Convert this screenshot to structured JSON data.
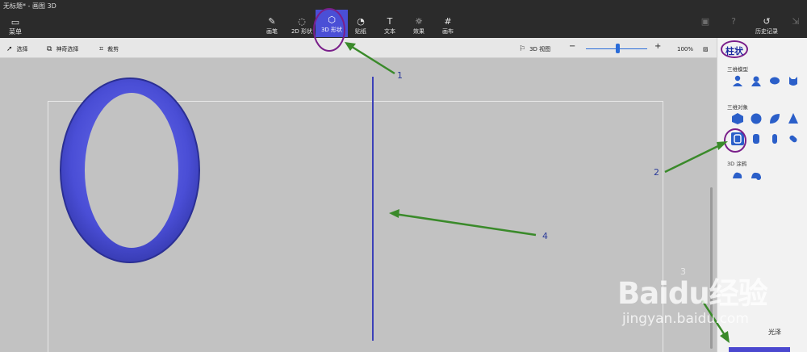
{
  "window": {
    "title": "无标题* - 画图 3D"
  },
  "menu": {
    "label": "菜单"
  },
  "toolbar": {
    "tools": [
      {
        "label": "画笔",
        "icon": "brush-icon"
      },
      {
        "label": "2D 形状",
        "icon": "2d-shapes-icon"
      },
      {
        "label": "3D 形状",
        "icon": "3d-shapes-icon"
      },
      {
        "label": "贴纸",
        "icon": "stickers-icon"
      },
      {
        "label": "文本",
        "icon": "text-icon"
      },
      {
        "label": "效果",
        "icon": "effects-icon"
      },
      {
        "label": "画布",
        "icon": "canvas-icon"
      }
    ],
    "history_label": "历史记录"
  },
  "subbar": {
    "select_label": "选择",
    "magic_select_label": "神奇选择",
    "crop_label": "裁剪",
    "view3d_label": "3D 视图",
    "zoom_value": "100%",
    "zoom_level": 0.52
  },
  "panel": {
    "title": "柱状",
    "section_models": "三维模型",
    "section_objects": "三维对象",
    "section_doodles": "3D 涂鸦",
    "gloss_label": "光泽"
  },
  "annotations": {
    "a1": "1",
    "a2": "2",
    "a3": "3",
    "a4": "4"
  },
  "watermark": {
    "main": "Baidu经验",
    "sub": "jingyan.baidu.com"
  },
  "colors": {
    "accent": "#4a4fd6",
    "ring": "#5a5fd8",
    "arrow": "#3a8a2a",
    "circle_mark": "#7a1f8a"
  }
}
